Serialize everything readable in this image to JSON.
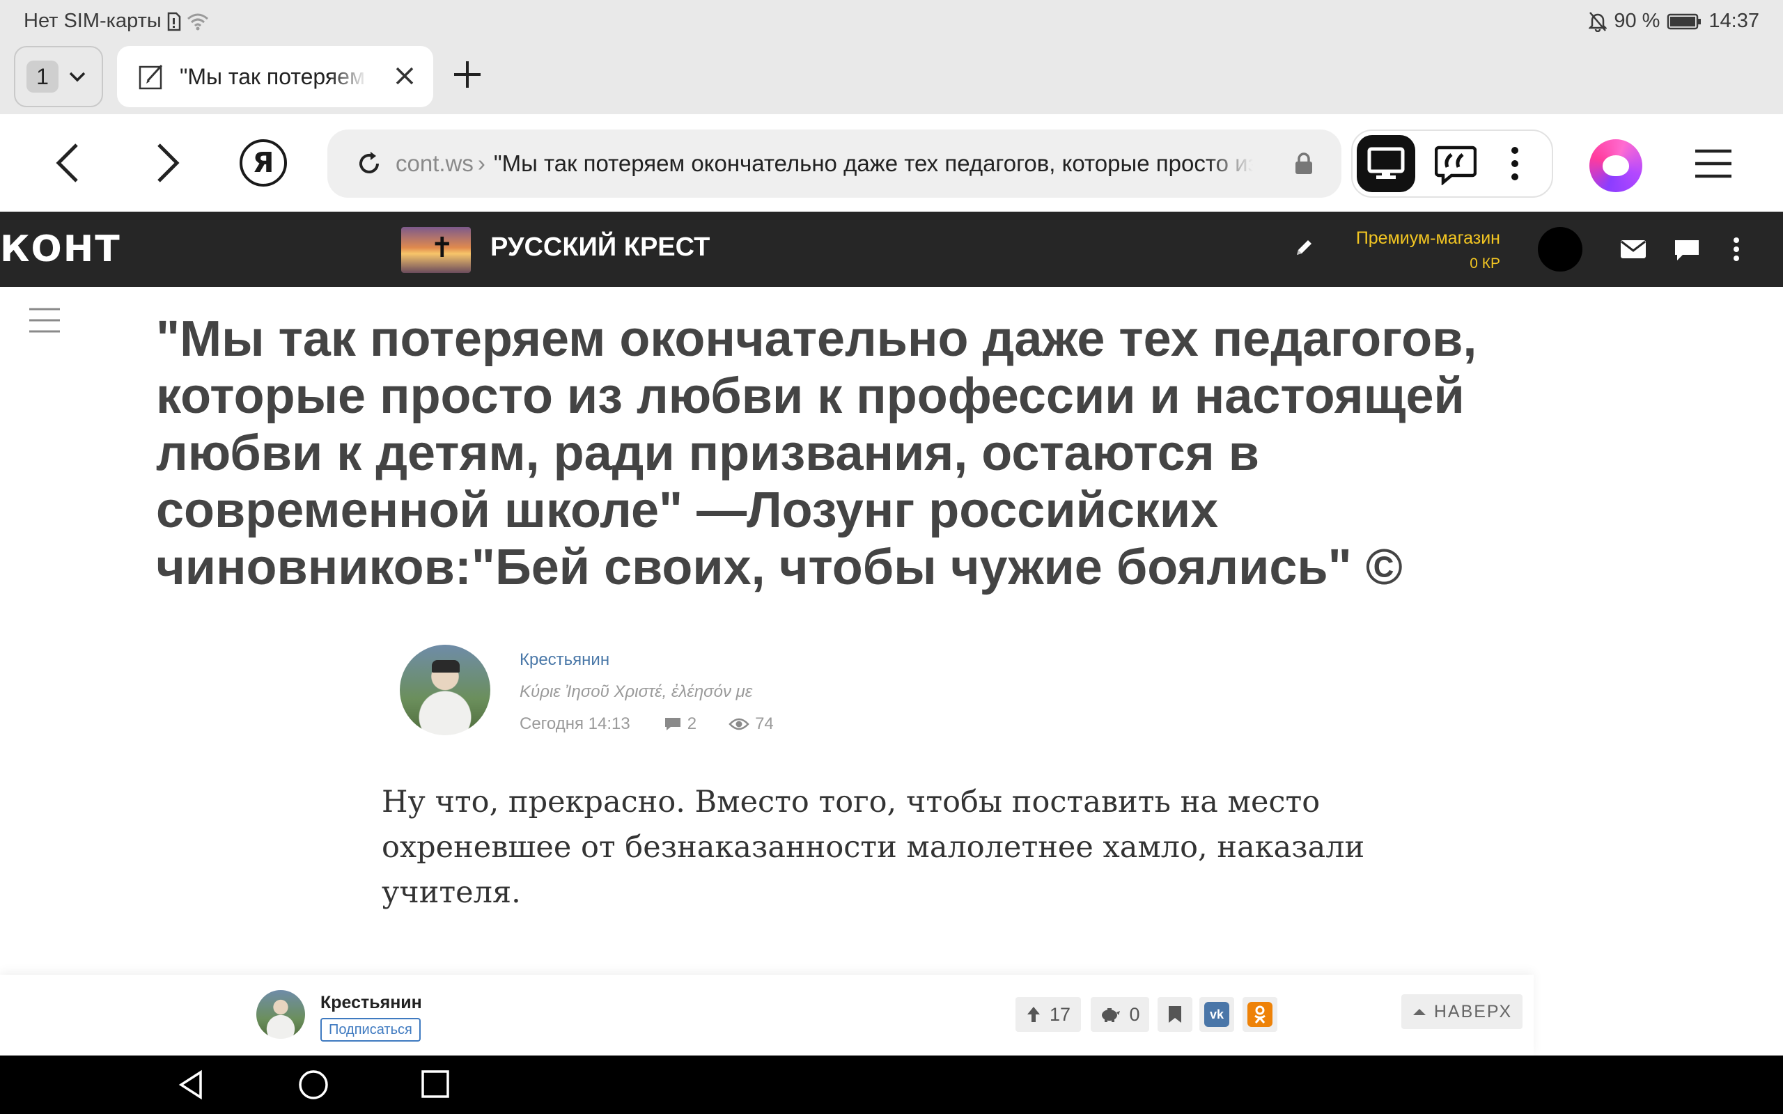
{
  "status_bar": {
    "carrier": "Нет SIM-карты",
    "battery": "90 %",
    "time": "14:37"
  },
  "tabs": {
    "count": "1",
    "active_title": "\"Мы так потеряем окончательно даже тех педагогов"
  },
  "address_bar": {
    "domain": "cont.ws",
    "separator": "›",
    "page_title": "\"Мы так потеряем окончательно даже тех педагогов, которые просто из любви к профессии"
  },
  "site_header": {
    "logo": "КОНТ",
    "blog_name": "РУССКИЙ КРЕСТ",
    "premium_label": "Премиум-магазин",
    "premium_balance": "0 КР"
  },
  "article": {
    "title": "\"Мы так потеряем окончательно даже тех педагогов, которые просто из любви к профессии и настоящей любви к детям, ради призвания, остаются в современной школе\" —Лозунг российских чиновников:\"Бей своих, чтобы чужие боялись\" ©",
    "author": {
      "name": "Крестьянин",
      "motto": "Κύριε Ἰησοῦ Χριστέ, ἐλέησόν με"
    },
    "date": "Сегодня 14:13",
    "comments": "2",
    "views": "74",
    "body": "Ну что, прекрасно. Вместо того, чтобы поставить на место охреневшее от безнаказанности малолетнее хамло, наказали учителя."
  },
  "footer_bar": {
    "author_name": "Крестьянин",
    "subscribe_label": "Подписаться",
    "upvotes": "17",
    "donations": "0",
    "to_top_label": "НАВЕРХ"
  },
  "colors": {
    "site_header_bg": "#262626",
    "premium_yellow": "#f3c622",
    "link_blue": "#4a78a8",
    "title_gray": "#444444",
    "vk_blue": "#4a76a8",
    "ok_orange": "#ee8208"
  },
  "icons": [
    "mute-icon",
    "sim-icon",
    "wifi-icon",
    "battery-icon",
    "chevron-down-icon",
    "article-icon",
    "close-icon",
    "plus-icon",
    "back-arrow-icon",
    "forward-arrow-icon",
    "yandex-icon",
    "reload-icon",
    "lock-icon",
    "desktop-icon",
    "quote-icon",
    "more-vert-icon",
    "alice-icon",
    "menu-icon",
    "pencil-icon",
    "mail-icon",
    "chat-icon",
    "comment-icon",
    "eye-icon",
    "arrow-up-icon",
    "piggy-bank-icon",
    "bookmark-icon",
    "vk-icon",
    "ok-icon",
    "nav-back-icon",
    "nav-home-icon",
    "nav-recents-icon"
  ]
}
